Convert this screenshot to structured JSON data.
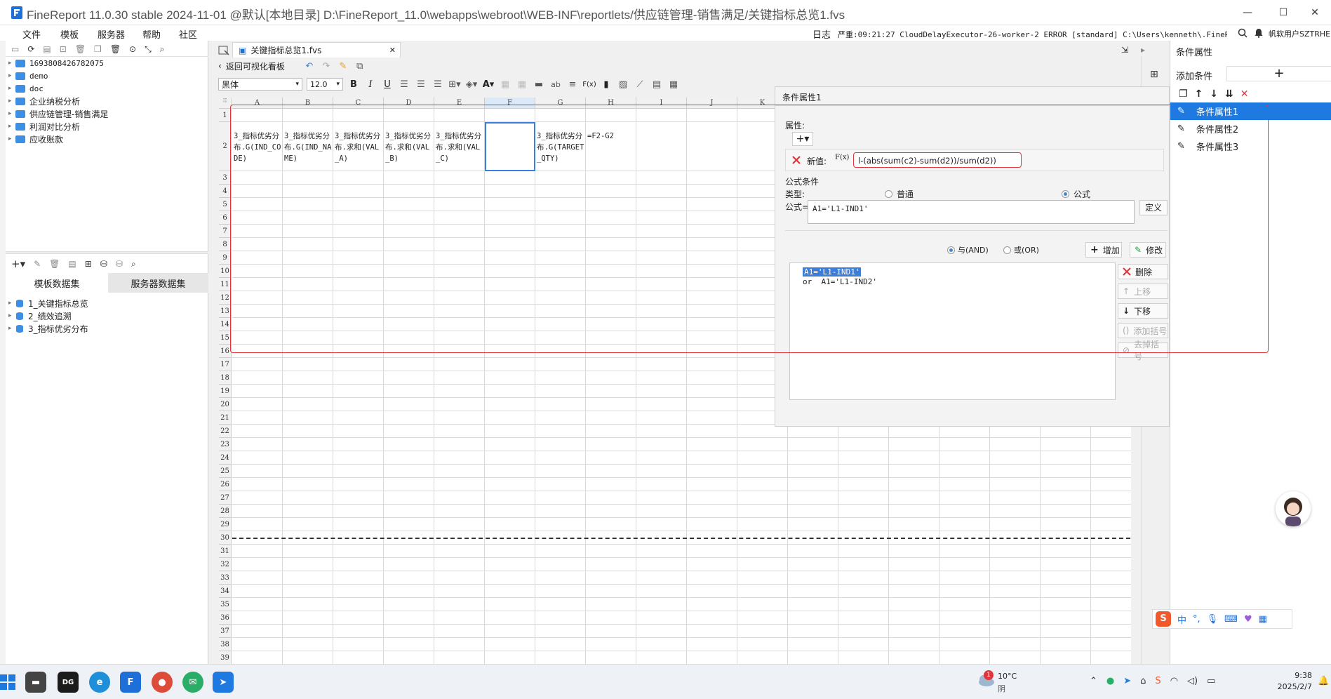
{
  "titlebar": {
    "title": "FineReport 11.0.30 stable 2024-11-01 @默认[本地目录]    D:\\FineReport_11.0\\webapps\\webroot\\WEB-INF\\reportlets/供应链管理-销售满足/关键指标总览1.fvs",
    "minimize": "—",
    "maximize": "☐",
    "close": "✕"
  },
  "menu": {
    "items": [
      "文件",
      "模板",
      "服务器",
      "帮助",
      "社区"
    ],
    "log_label": "日志",
    "log_text": "严重:09:21:27 CloudDelayExecutor-26-worker-2 ERROR [standard] C:\\Users\\kenneth\\.FineReport...",
    "user": "帆软用户SZTRHE"
  },
  "template_tree": {
    "items": [
      "1693808426782075",
      "demo",
      "doc",
      "企业纳税分析",
      "供应链管理-销售满足",
      "利润对比分析",
      "应收账款"
    ]
  },
  "dataset_panel": {
    "tabs": [
      "模板数据集",
      "服务器数据集"
    ],
    "items": [
      "1_关键指标总览",
      "2_绩效追溯",
      "3_指标优劣分布"
    ]
  },
  "doc_tab": {
    "label": "关键指标总览1.fvs",
    "close": "✕"
  },
  "toolbar": {
    "back_label": "返回可视化看板",
    "font_name": "黑体",
    "font_size": "12.0",
    "bold": "B",
    "italic": "I",
    "underline": "U",
    "formula_icon": "F(x)"
  },
  "sheet": {
    "columns": [
      "A",
      "B",
      "C",
      "D",
      "E",
      "F",
      "G",
      "H",
      "I",
      "J",
      "K"
    ],
    "rows": [
      "1",
      "2",
      "3",
      "4",
      "5",
      "6",
      "7",
      "8",
      "9",
      "10",
      "11",
      "12",
      "13",
      "14",
      "15",
      "16",
      "17",
      "18",
      "19",
      "20",
      "21",
      "22",
      "23",
      "24",
      "25",
      "26",
      "27",
      "28",
      "29",
      "30",
      "31",
      "32",
      "33",
      "34",
      "35",
      "36",
      "37",
      "38",
      "39"
    ],
    "row2_cells": [
      "3_指标优劣分布.G(IND_CODE)",
      "3_指标优劣分布.G(IND_NAME)",
      "3_指标优劣分布.求和(VAL_A)",
      "3_指标优劣分布.求和(VAL_B)",
      "3_指标优劣分布.求和(VAL_C)",
      "",
      "3_指标优劣分布.G(TARGET_QTY)",
      "=F2-G2"
    ]
  },
  "dialog": {
    "title": "条件属性1",
    "attr_label": "属性:",
    "add_icon": "+▾",
    "new_value_label": "新值:",
    "fx_label": "F(x)",
    "new_value_formula": "l-(abs(sum(c2)-sum(d2))/sum(d2))",
    "formula_cond_label": "公式条件",
    "type_label": "类型:",
    "type_normal": "普通",
    "type_formula": "公式",
    "formula_label": "公式=",
    "formula_value": "A1='L1-IND1'",
    "define_button": "定义",
    "and_label": "与(AND)",
    "or_label": "或(OR)",
    "add_button": "增加",
    "modify_button": "修改",
    "conditions": [
      "A1='L1-IND1'",
      "or  A1='L1-IND2'"
    ],
    "side_buttons": [
      "删除",
      "上移",
      "下移",
      "添加括号",
      "去掉括号"
    ]
  },
  "right_panel": {
    "title": "条件属性",
    "add_condition": "添加条件",
    "add_icon": "+",
    "conditions": [
      "条件属性1",
      "条件属性2",
      "条件属性3"
    ]
  },
  "ime": {
    "label": "中"
  },
  "taskbar": {
    "weather_temp": "10°C",
    "weather_desc": "阴",
    "weather_badge": "1",
    "time": "9:38",
    "date": "2025/2/7"
  },
  "colors": {
    "accent": "#1f6fd8",
    "selected_row": "#1e7ae0",
    "highlight_red": "#e0353a",
    "folder": "#3d8fe5"
  }
}
